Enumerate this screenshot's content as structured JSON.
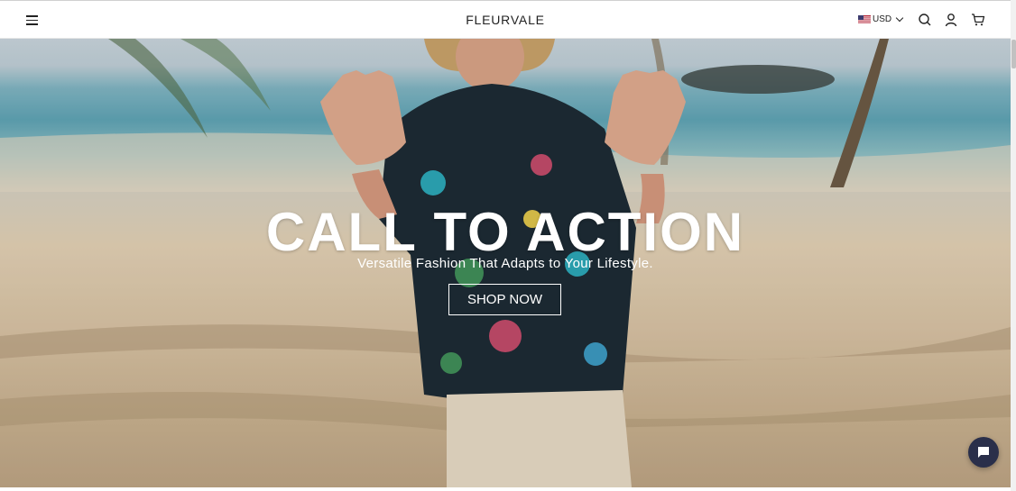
{
  "header": {
    "logo": "FLEURVALE",
    "currency": "USD"
  },
  "hero": {
    "title": "CALL TO ACTION",
    "subtitle": "Versatile Fashion That Adapts to Your Lifestyle.",
    "button_label": "SHOP NOW"
  },
  "colors": {
    "chat_button": "#2a2f4a",
    "text_on_hero": "#ffffff"
  },
  "icons": [
    "menu-icon",
    "us-flag-icon",
    "chevron-down-icon",
    "search-icon",
    "account-icon",
    "cart-icon",
    "chat-icon"
  ]
}
